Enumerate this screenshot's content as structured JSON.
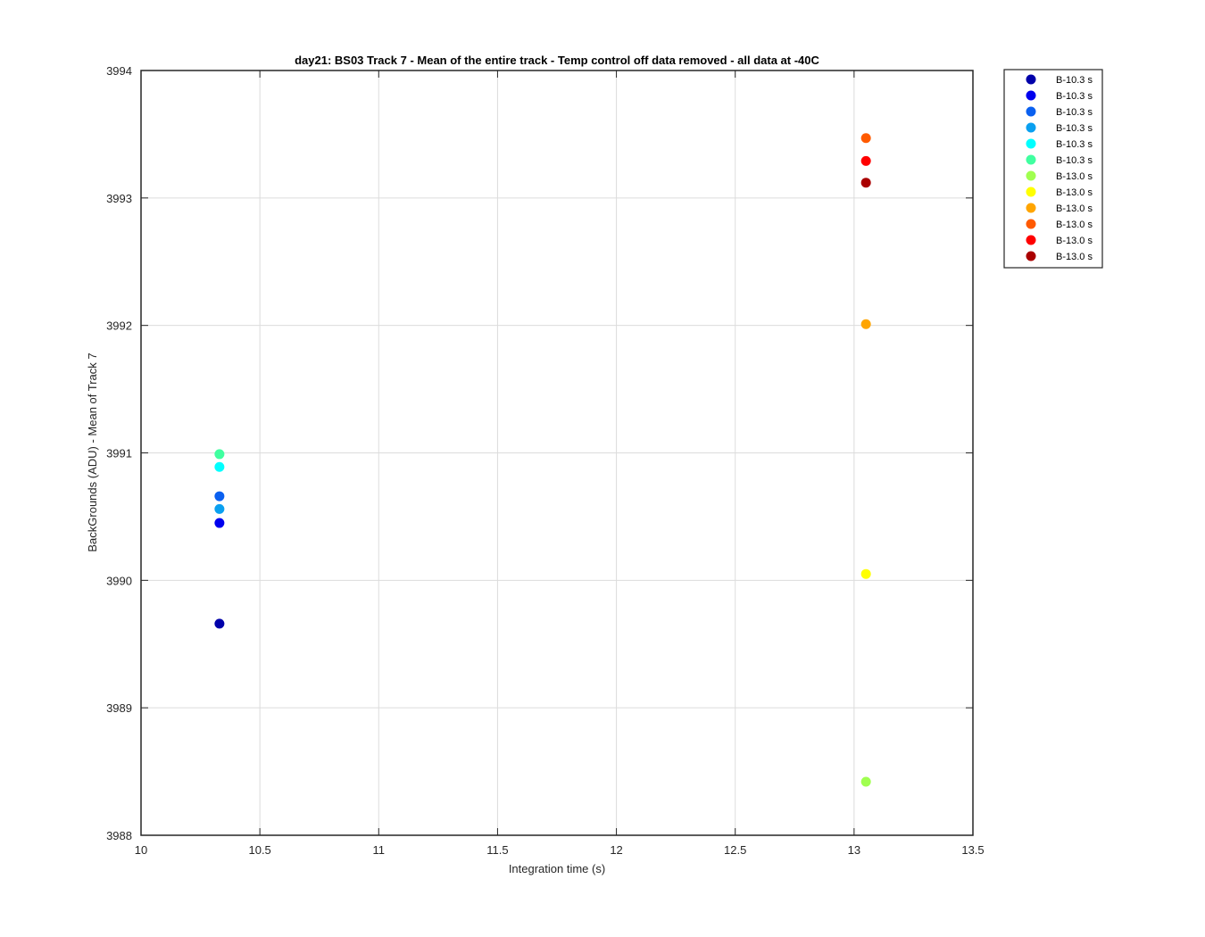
{
  "chart_data": {
    "type": "scatter",
    "title": "day21: BS03  Track 7 - Mean of the entire track - Temp control off data removed - all data at -40C",
    "xlabel": "Integration time (s)",
    "ylabel": "BackGrounds (ADU) - Mean of Track 7",
    "xlim": [
      10,
      13.5
    ],
    "ylim": [
      3988,
      3994
    ],
    "xticks": [
      "10",
      "10.5",
      "11",
      "11.5",
      "12",
      "12.5",
      "13",
      "13.5"
    ],
    "yticks": [
      "3988",
      "3989",
      "3990",
      "3991",
      "3992",
      "3993",
      "3994"
    ],
    "grid": true,
    "legend_position": "outside-top-right",
    "series": [
      {
        "name": "B-10.3 s",
        "color": "#0000aa",
        "x": 10.33,
        "y": 3989.66
      },
      {
        "name": "B-10.3 s",
        "color": "#0000ee",
        "x": 10.33,
        "y": 3990.45
      },
      {
        "name": "B-10.3 s",
        "color": "#0a60f0",
        "x": 10.33,
        "y": 3990.66
      },
      {
        "name": "B-10.3 s",
        "color": "#0aa0f0",
        "x": 10.33,
        "y": 3990.56
      },
      {
        "name": "B-10.3 s",
        "color": "#00ffff",
        "x": 10.33,
        "y": 3990.89
      },
      {
        "name": "B-10.3 s",
        "color": "#40ffa0",
        "x": 10.33,
        "y": 3990.99
      },
      {
        "name": "B-13.0 s",
        "color": "#a0ff50",
        "x": 13.05,
        "y": 3988.42
      },
      {
        "name": "B-13.0 s",
        "color": "#ffff00",
        "x": 13.05,
        "y": 3990.05
      },
      {
        "name": "B-13.0 s",
        "color": "#ffa500",
        "x": 13.05,
        "y": 3992.01
      },
      {
        "name": "B-13.0 s",
        "color": "#ff5a00",
        "x": 13.05,
        "y": 3993.47
      },
      {
        "name": "B-13.0 s",
        "color": "#ff0000",
        "x": 13.05,
        "y": 3993.29
      },
      {
        "name": "B-13.0 s",
        "color": "#aa0000",
        "x": 13.05,
        "y": 3993.12
      }
    ]
  }
}
